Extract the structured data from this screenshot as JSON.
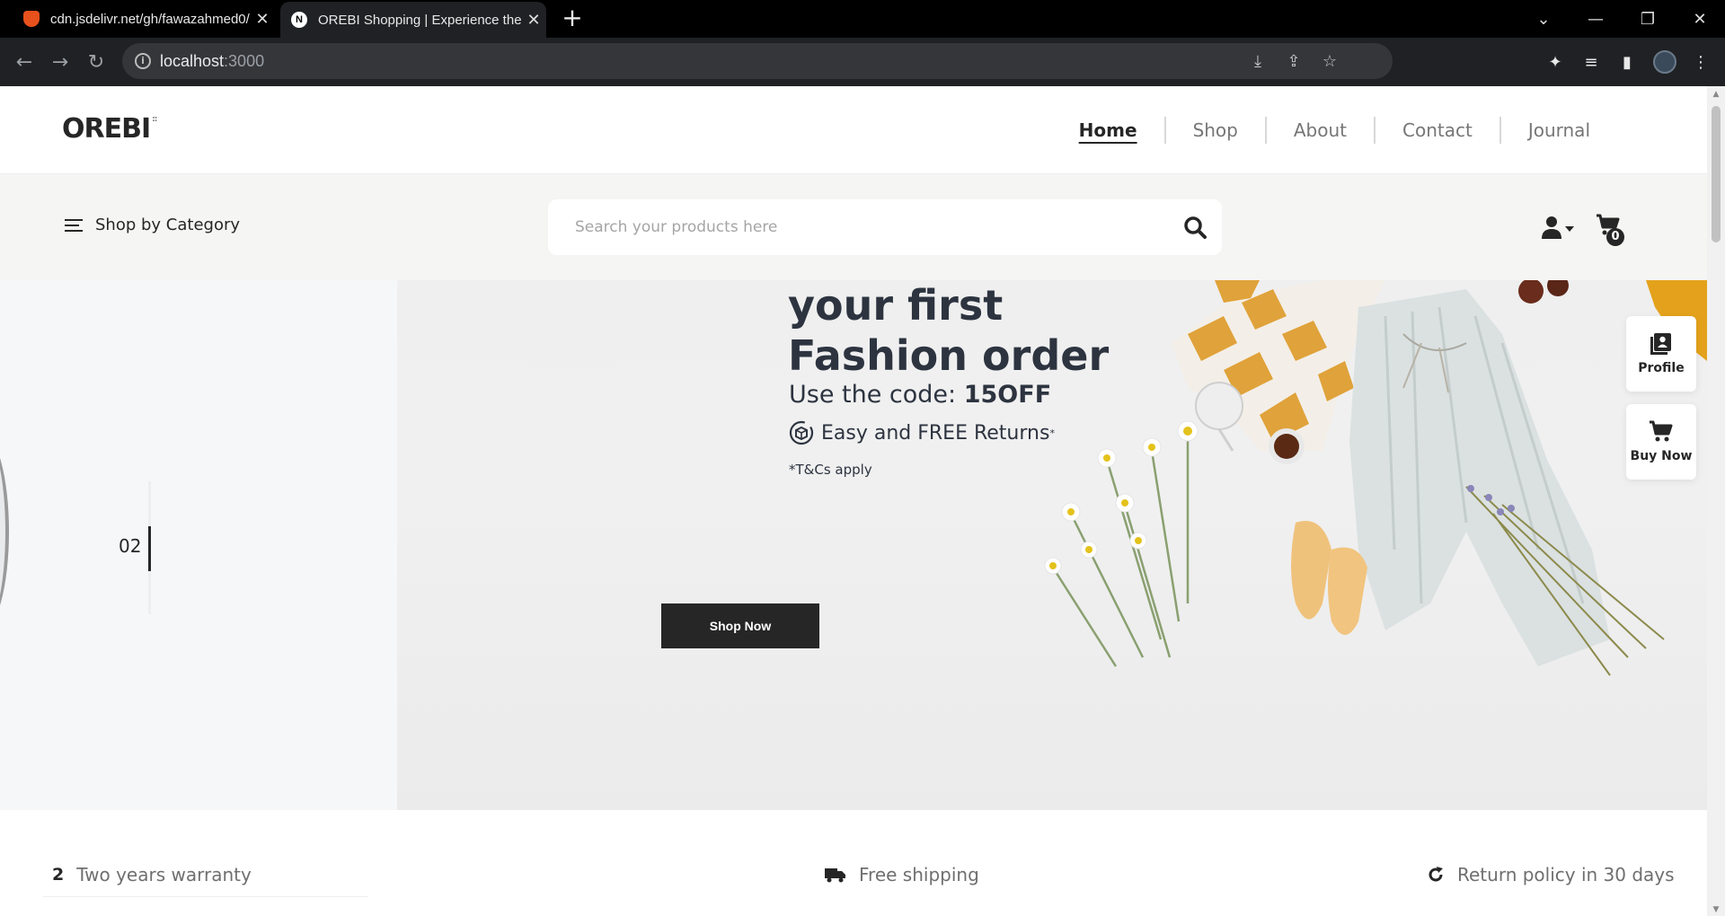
{
  "browser": {
    "tabs": [
      {
        "title": "cdn.jsdelivr.net/gh/fawazahmed0/"
      },
      {
        "title": "OREBI Shopping | Experience the"
      }
    ],
    "new_tab": "+",
    "url_host": "localhost",
    "url_port": ":3000"
  },
  "header": {
    "logo": "OREBI",
    "nav": [
      "Home",
      "Shop",
      "About",
      "Contact",
      "Journal"
    ]
  },
  "catbar": {
    "shop_by_category": "Shop by Category",
    "search_placeholder": "Search your products here",
    "cart_count": "0"
  },
  "hero": {
    "slide_number": "02",
    "headline_line1": "your first",
    "headline_line2": "Fashion order",
    "code_prefix": "Use the code: ",
    "code": "15OFF",
    "returns": "Easy and FREE Returns",
    "returns_mark": "*",
    "tcs": "*T&Cs apply",
    "cta": "Shop Now"
  },
  "side_actions": {
    "profile": "Profile",
    "buy_now": "Buy Now"
  },
  "info": {
    "warranty_icon": "2",
    "warranty": "Two years warranty",
    "shipping": "Free shipping",
    "returns": "Return policy in 30 days"
  },
  "colors": {
    "primary": "#262626",
    "nav_inactive": "#767676",
    "catbar_bg": "#f5f5f3",
    "banner_text": "#2d3440"
  }
}
